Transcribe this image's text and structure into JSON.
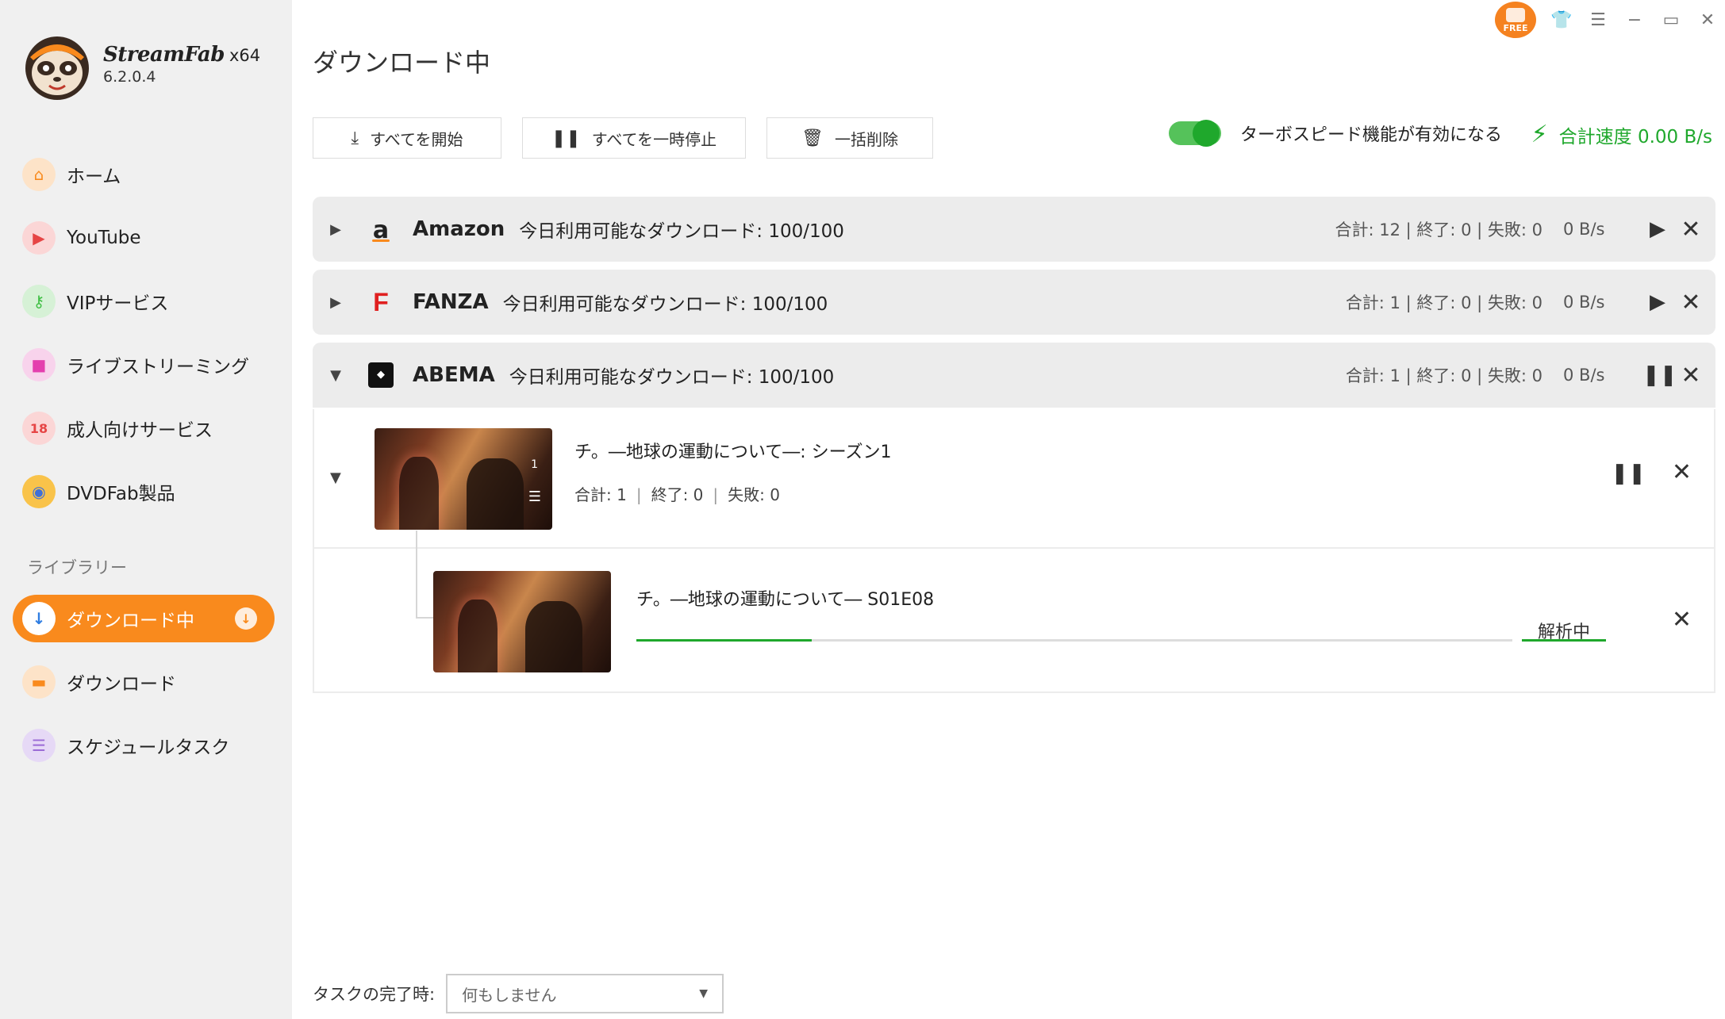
{
  "app": {
    "brand_name": "StreamFab",
    "arch": "x64",
    "version": "6.2.0.4",
    "free_badge": "FREE"
  },
  "sidebar": {
    "items": [
      {
        "label": "ホーム",
        "icon": "home-icon",
        "color": "#f98a1d"
      },
      {
        "label": "YouTube",
        "icon": "youtube-icon",
        "color": "#e64545"
      },
      {
        "label": "VIPサービス",
        "icon": "key-icon",
        "color": "#3fbf44"
      },
      {
        "label": "ライブストリーミング",
        "icon": "video-camera-icon",
        "color": "#e43fae"
      },
      {
        "label": "成人向けサービス",
        "icon": "adult-18-icon",
        "color": "#e64545"
      },
      {
        "label": "DVDFab製品",
        "icon": "dvdfab-icon",
        "color": "#3f6fd8"
      }
    ],
    "library_label": "ライブラリー",
    "library_items": [
      {
        "label": "ダウンロード中",
        "icon": "download-arrow-icon",
        "active": true
      },
      {
        "label": "ダウンロード",
        "icon": "folder-icon",
        "active": false
      },
      {
        "label": "スケジュールタスク",
        "icon": "schedule-list-icon",
        "active": false
      }
    ]
  },
  "main": {
    "title": "ダウンロード中",
    "toolbar": {
      "start_all": "すべてを開始",
      "pause_all": "すべてを一時停止",
      "delete_all": "一括削除"
    },
    "turbo_label": "ターボスピード機能が有効になる",
    "turbo_enabled": true,
    "total_speed": "合計速度 0.00 B/s",
    "groups": [
      {
        "name": "Amazon",
        "logo": "a",
        "avail": "今日利用可能なダウンロード: 100/100",
        "stats": "合計: 12 | 終了: 0 | 失敗: 0",
        "speed": "0 B/s",
        "state": "paused"
      },
      {
        "name": "FANZA",
        "logo": "F",
        "avail": "今日利用可能なダウンロード: 100/100",
        "stats": "合計: 1 | 終了: 0 | 失敗: 0",
        "speed": "0 B/s",
        "state": "paused"
      },
      {
        "name": "ABEMA",
        "logo": "abema-logo",
        "avail": "今日利用可能なダウンロード: 100/100",
        "stats": "合計: 1 | 終了: 0 | 失敗: 0",
        "speed": "0 B/s",
        "state": "running"
      }
    ],
    "season": {
      "title": "チ。―地球の運動について―: シーズン1",
      "total_label": "合計: 1",
      "done_label": "終了: 0",
      "fail_label": "失敗: 0",
      "episode_count_badge": "1"
    },
    "episode": {
      "title": "チ。―地球の運動について― S01E08",
      "status": "解析中",
      "progress": 0.2
    },
    "footer": {
      "label": "タスクの完了時:",
      "selected": "何もしません"
    }
  },
  "colors": {
    "accent": "#f98a1d",
    "green": "#1fa82c",
    "amazon": "#f98a1d",
    "fanza": "#e02020"
  }
}
